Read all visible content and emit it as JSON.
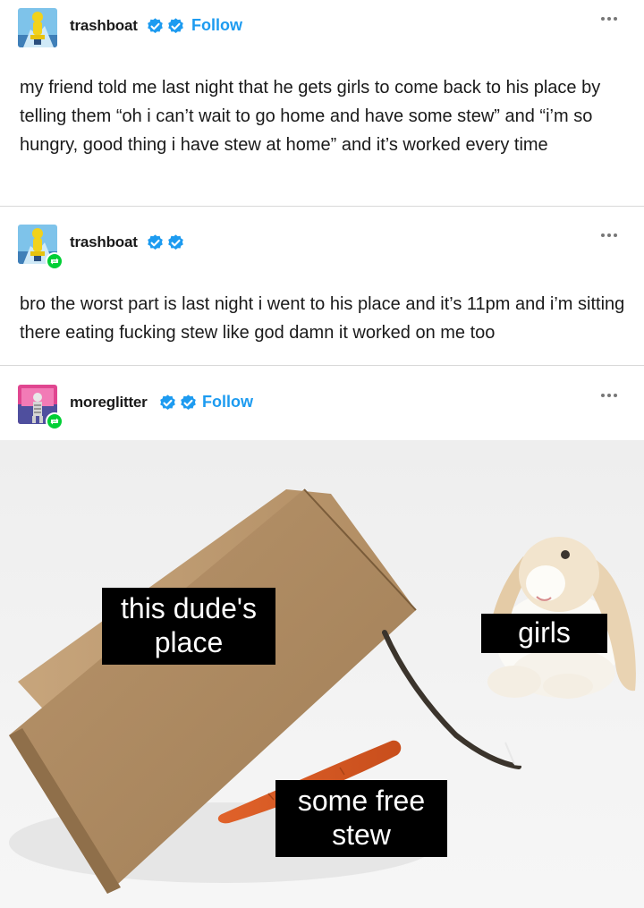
{
  "posts": [
    {
      "username": "trashboat",
      "follow_label": "Follow",
      "text": "my friend told me last night that he gets girls to come back to his place by telling them “oh i can’t wait to go home and have some stew” and “i’m so hungry, good thing i have stew at home” and it’s worked every time"
    },
    {
      "username": "trashboat",
      "text": "bro the worst part is last night i went to his place and it’s 11pm and i’m sitting there eating fucking stew like god damn it worked on me too"
    },
    {
      "username": "moreglitter",
      "follow_label": "Follow"
    }
  ],
  "meme": {
    "captions": {
      "box": "this dude's place",
      "bunny": "girls",
      "carrot": "some free stew"
    }
  },
  "colors": {
    "follow": "#1d9bf0",
    "verified": "#1d9bf0",
    "reblog": "#00cf35",
    "divider": "#d9d9d9"
  },
  "icons": {
    "verified": "verified-badge-icon",
    "reblog": "reblog-icon",
    "more": "more-options-icon"
  }
}
